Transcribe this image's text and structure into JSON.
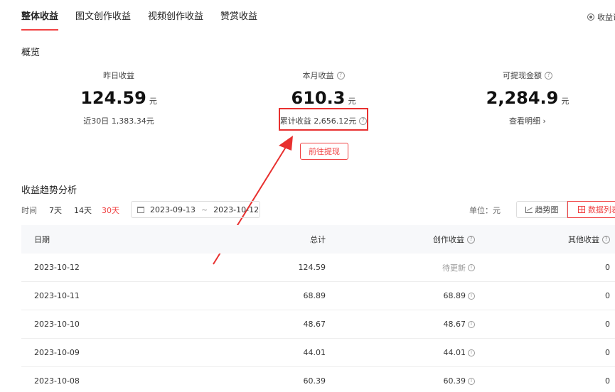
{
  "tabs": [
    {
      "label": "整体收益",
      "active": true
    },
    {
      "label": "图文创作收益",
      "active": false
    },
    {
      "label": "视频创作收益",
      "active": false
    },
    {
      "label": "赞赏收益",
      "active": false
    }
  ],
  "top_right_label": "收益说",
  "overview": {
    "title": "概览",
    "yesterday": {
      "label": "昨日收益",
      "value": "124.59",
      "unit": "元",
      "sub": "近30日 1,383.34元"
    },
    "month": {
      "label": "本月收益",
      "value": "610.3",
      "unit": "元",
      "sub": "累计收益 2,656.12元"
    },
    "withdrawable": {
      "label": "可提现金额",
      "value": "2,284.9",
      "unit": "元",
      "sub": "查看明细 ›"
    },
    "withdraw_button": "前往提现"
  },
  "trend": {
    "title": "收益趋势分析",
    "time_label": "时间",
    "ranges": [
      "7天",
      "14天",
      "30天"
    ],
    "active_range": "30天",
    "start_date": "2023-09-13",
    "date_sep": "~",
    "end_date": "2023-10-12",
    "unit_label": "单位：元",
    "trend_button": "趋势图",
    "list_button": "数据列表"
  },
  "table": {
    "headers": [
      "日期",
      "总计",
      "创作收益",
      "其他收益"
    ],
    "rows": [
      {
        "date": "2023-10-12",
        "total": "124.59",
        "creation": "待更新",
        "other": "0",
        "pending": true
      },
      {
        "date": "2023-10-11",
        "total": "68.89",
        "creation": "68.89",
        "other": "0",
        "pending": false
      },
      {
        "date": "2023-10-10",
        "total": "48.67",
        "creation": "48.67",
        "other": "0",
        "pending": false
      },
      {
        "date": "2023-10-09",
        "total": "44.01",
        "creation": "44.01",
        "other": "0",
        "pending": false
      },
      {
        "date": "2023-10-08",
        "total": "60.39",
        "creation": "60.39",
        "other": "0",
        "pending": false
      }
    ]
  },
  "colors": {
    "accent": "#f04142",
    "highlight": "#e8302f",
    "header_bg": "#f7f8fa"
  }
}
